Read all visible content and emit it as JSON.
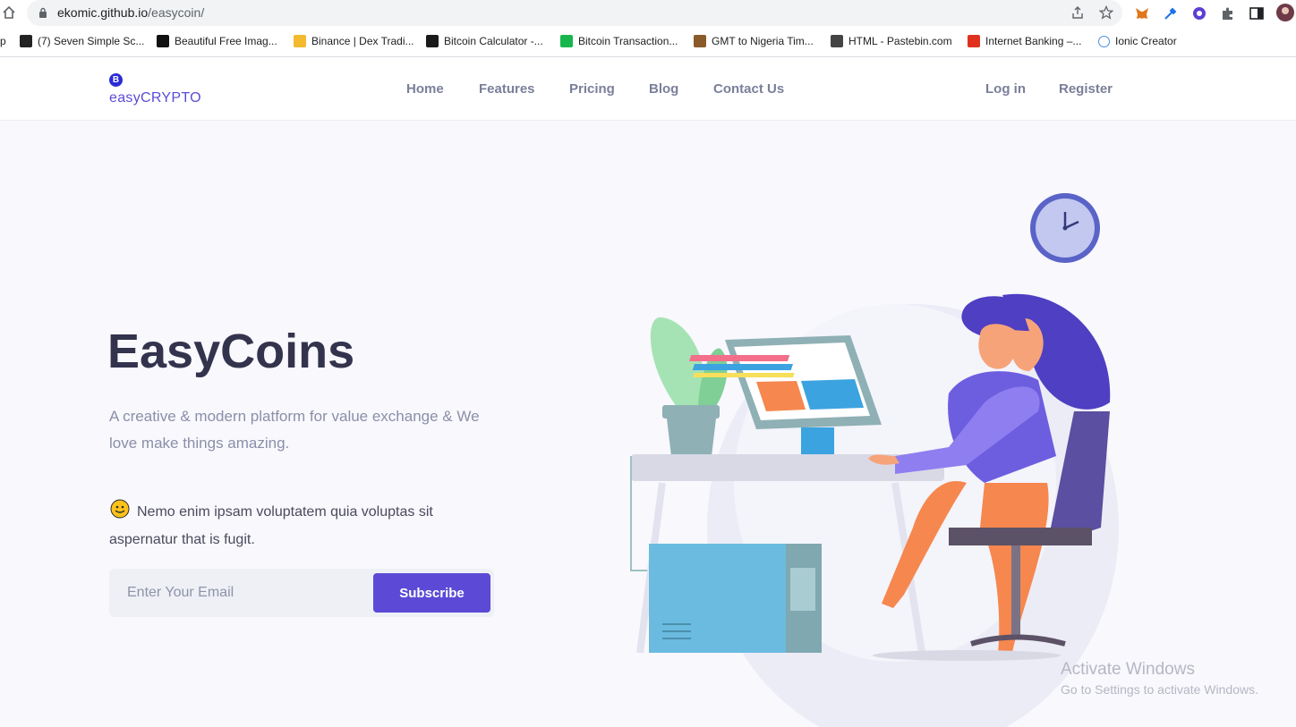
{
  "browser": {
    "url_host": "ekomic.github.io",
    "url_path": "/easycoin/",
    "bookmarks": [
      {
        "label": "p",
        "icon": "none"
      },
      {
        "label": "(7) Seven Simple Sc...",
        "icon": "chess-icon"
      },
      {
        "label": "Beautiful Free Imag...",
        "icon": "unsplash-icon"
      },
      {
        "label": "Binance | Dex Tradi...",
        "icon": "binance-icon"
      },
      {
        "label": "Bitcoin Calculator -...",
        "icon": "calculator-icon"
      },
      {
        "label": "Bitcoin Transaction...",
        "icon": "tx-icon"
      },
      {
        "label": "GMT to Nigeria Tim...",
        "icon": "clock-icon"
      },
      {
        "label": "HTML - Pastebin.com",
        "icon": "pastebin-icon"
      },
      {
        "label": "Internet Banking –...",
        "icon": "bank-icon"
      },
      {
        "label": "Ionic Creator",
        "icon": "ionic-icon"
      }
    ]
  },
  "nav": {
    "logo_symbol": "B",
    "logo": "easyCRYPTO",
    "links": [
      "Home",
      "Features",
      "Pricing",
      "Blog",
      "Contact Us"
    ],
    "login": "Log in",
    "register": "Register"
  },
  "hero": {
    "title": "EasyCoins",
    "subtitle": "A creative & modern platform for value exchange & We love make things amazing.",
    "note": "Nemo enim ipsam voluptatem quia voluptas sit aspernatur that is fugit.",
    "email_placeholder": "Enter Your Email",
    "subscribe": "Subscribe"
  },
  "watermark": {
    "line1": "Activate Windows",
    "line2": "Go to Settings to activate Windows."
  },
  "colors": {
    "accent": "#5c4ad6",
    "title": "#33334d",
    "muted": "#8b8fa8"
  }
}
